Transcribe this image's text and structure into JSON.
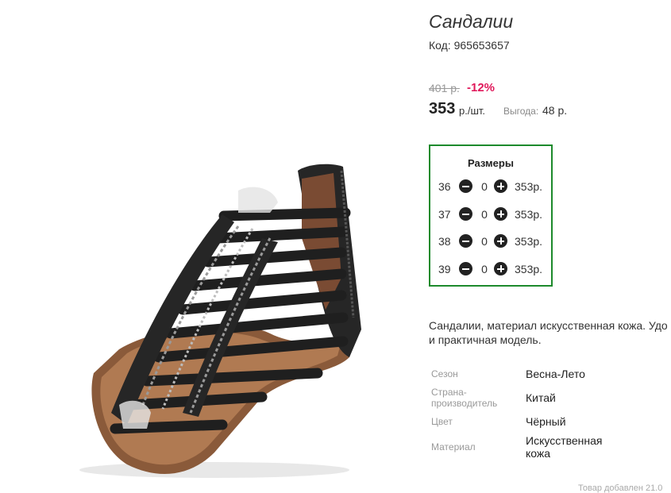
{
  "product": {
    "title": "Сандалии",
    "code": "Код: 965653657",
    "old_price": "401 р.",
    "discount": "-12%",
    "price": "353",
    "unit": "р./шт.",
    "benefit_label": "Выгода:",
    "benefit_value": "48 р.",
    "image_icon": "sandal-photo"
  },
  "sizes": {
    "title": "Размеры",
    "rows": [
      {
        "size": "36",
        "qty": "0",
        "price": "353р."
      },
      {
        "size": "37",
        "qty": "0",
        "price": "353р."
      },
      {
        "size": "38",
        "qty": "0",
        "price": "353р."
      },
      {
        "size": "39",
        "qty": "0",
        "price": "353р."
      }
    ],
    "minus_icon": "minus-circle-icon",
    "plus_icon": "plus-circle-icon",
    "border_color": "#1d8a2c"
  },
  "description": {
    "line1": "Сандалии, материал искусственная кожа. Удо",
    "line2": "и практичная модель."
  },
  "attributes": [
    {
      "label": "Сезон",
      "value": "Весна-Лето"
    },
    {
      "label": "Страна-производитель",
      "value": "Китай"
    },
    {
      "label": "Цвет",
      "value": "Чёрный"
    },
    {
      "label": "Материал",
      "value": "Искусственная кожа"
    }
  ],
  "footer": {
    "text": "Товар добавлен 21.0"
  },
  "colors": {
    "discount": "#e0185a",
    "accent_border": "#1d8a2c"
  }
}
